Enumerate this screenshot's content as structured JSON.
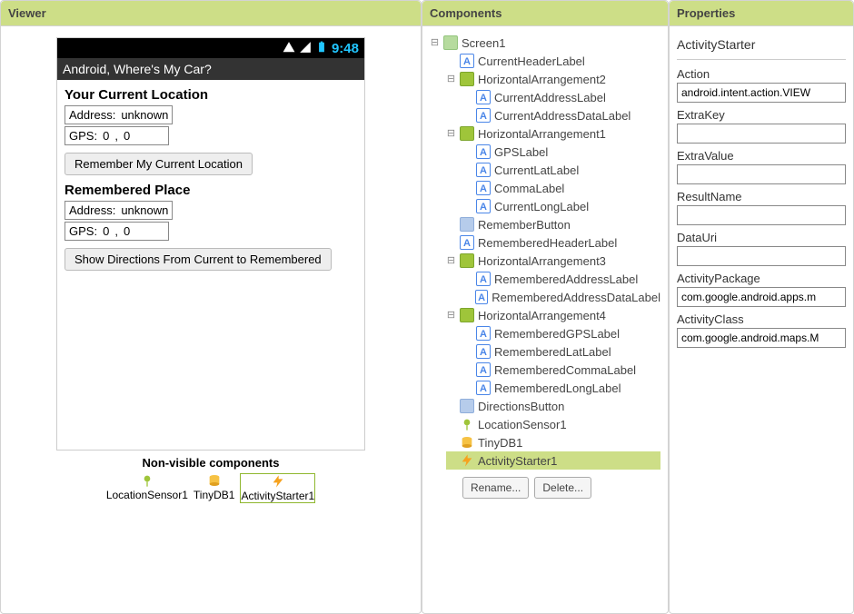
{
  "viewer": {
    "title": "Viewer",
    "phone": {
      "clock": "9:48",
      "app_title": "Android, Where's My Car?",
      "section1_heading": "Your Current Location",
      "addr_label": "Address:",
      "addr_value": "unknown",
      "gps_label": "GPS:",
      "gps_lat": "0",
      "gps_comma": ",",
      "gps_lon": "0",
      "remember_btn": "Remember My Current Location",
      "section2_heading": "Remembered Place",
      "addr2_label": "Address:",
      "addr2_value": "unknown",
      "gps2_label": "GPS:",
      "gps2_lat": "0",
      "gps2_comma": ",",
      "gps2_lon": "0",
      "directions_btn": "Show Directions From Current to Remembered"
    },
    "nonvisible": {
      "title": "Non-visible components",
      "locationsensor": "LocationSensor1",
      "tinydb": "TinyDB1",
      "activitystarter": "ActivityStarter1"
    }
  },
  "components": {
    "title": "Components",
    "tree": {
      "screen": "Screen1",
      "currentHeader": "CurrentHeaderLabel",
      "harr2": "HorizontalArrangement2",
      "curAddr": "CurrentAddressLabel",
      "curAddrData": "CurrentAddressDataLabel",
      "harr1": "HorizontalArrangement1",
      "gpsLabel": "GPSLabel",
      "curLat": "CurrentLatLabel",
      "comma": "CommaLabel",
      "curLong": "CurrentLongLabel",
      "rememberBtn": "RememberButton",
      "remHeader": "RememberedHeaderLabel",
      "harr3": "HorizontalArrangement3",
      "remAddr": "RememberedAddressLabel",
      "remAddrData": "RememberedAddressDataLabel",
      "harr4": "HorizontalArrangement4",
      "remGps": "RememberedGPSLabel",
      "remLat": "RememberedLatLabel",
      "remComma": "RememberedCommaLabel",
      "remLong": "RememberedLongLabel",
      "directionsBtn": "DirectionsButton",
      "locSensor": "LocationSensor1",
      "tinyDb": "TinyDB1",
      "actStarter": "ActivityStarter1"
    },
    "rename_btn": "Rename...",
    "delete_btn": "Delete..."
  },
  "properties": {
    "title": "Properties",
    "component_name": "ActivityStarter",
    "labels": {
      "action": "Action",
      "extrakey": "ExtraKey",
      "extravalue": "ExtraValue",
      "resultname": "ResultName",
      "datauri": "DataUri",
      "activitypackage": "ActivityPackage",
      "activityclass": "ActivityClass"
    },
    "values": {
      "action": "android.intent.action.VIEW",
      "extrakey": "",
      "extravalue": "",
      "resultname": "",
      "datauri": "",
      "activitypackage": "com.google.android.apps.m",
      "activityclass": "com.google.android.maps.M"
    }
  }
}
